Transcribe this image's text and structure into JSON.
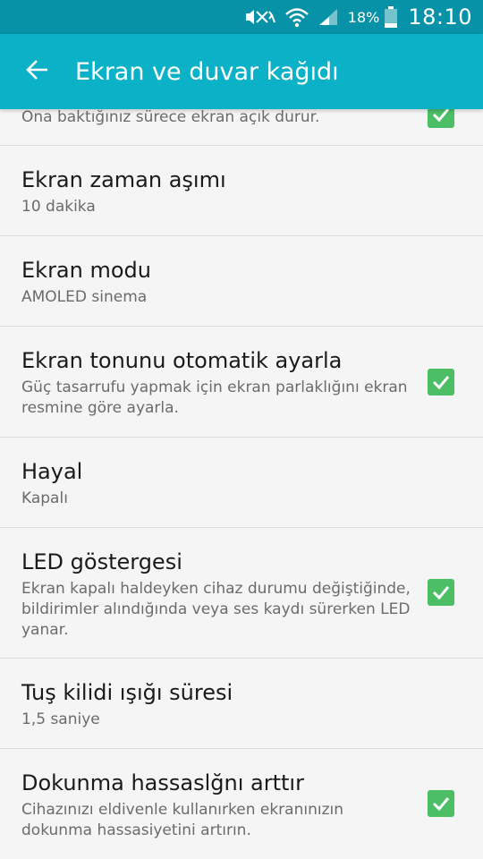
{
  "status_bar": {
    "icons": [
      "mute-icon",
      "wifi-icon",
      "signal-icon",
      "battery-icon"
    ],
    "battery_percent": "18%",
    "time": "18:10"
  },
  "app_bar": {
    "back_icon": "arrow-back-icon",
    "title": "Ekran ve duvar kağıdı"
  },
  "settings": [
    {
      "title": "",
      "subtitle": "Ona baktığınız sürece ekran açık durur.",
      "checked": true
    },
    {
      "title": "Ekran zaman aşımı",
      "subtitle": "10 dakika"
    },
    {
      "title": "Ekran modu",
      "subtitle": "AMOLED sinema"
    },
    {
      "title": "Ekran tonunu otomatik ayarla",
      "subtitle": "Güç tasarrufu yapmak için ekran parlaklığını ekran resmine göre ayarla.",
      "checked": true
    },
    {
      "title": "Hayal",
      "subtitle": "Kapalı"
    },
    {
      "title": "LED göstergesi",
      "subtitle": "Ekran kapalı haldeyken cihaz durumu değiştiğinde, bildirimler alındığında veya ses kaydı sürerken LED yanar.",
      "checked": true
    },
    {
      "title": "Tuş kilidi ışığı süresi",
      "subtitle": "1,5 saniye"
    },
    {
      "title": "Dokunma hassaslğnı arttır",
      "subtitle": "Cihazınızı eldivenle kullanırken ekranınızın dokunma hassasiyetini artırın.",
      "checked": true
    }
  ],
  "colors": {
    "status_bar": "#0792a7",
    "app_bar": "#0ab1c7",
    "checkbox": "#4cbf66",
    "background": "#f5f5f5"
  }
}
